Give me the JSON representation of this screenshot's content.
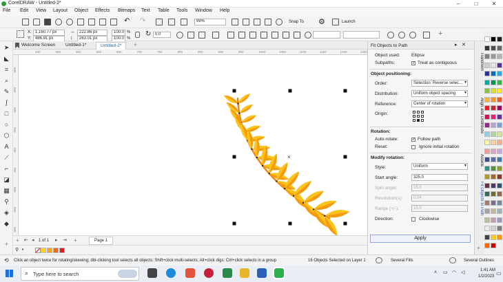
{
  "window": {
    "title": "CorelDRAW - Untitled-2*",
    "min": "–",
    "max": "□",
    "close": "✕"
  },
  "menu": [
    "File",
    "Edit",
    "View",
    "Layout",
    "Object",
    "Effects",
    "Bitmaps",
    "Text",
    "Table",
    "Tools",
    "Window",
    "Help"
  ],
  "toolbar1": {
    "zoom": "99%",
    "snap_to": "Snap To",
    "launch": "Launch"
  },
  "property_bar": {
    "x": "1,160.77 px",
    "y": "486.91 px",
    "width": "222.86 px",
    "height": "263.01 px",
    "scale_w": "100.0",
    "scale_h": "100.0",
    "pct": "%",
    "angle": "0.0",
    "x_label": "X:",
    "y_label": "Y:"
  },
  "tabs": [
    {
      "label": "Welcome Screen",
      "active": false
    },
    {
      "label": "Untitled-1*",
      "active": false
    },
    {
      "label": "Untitled-2*",
      "active": true
    }
  ],
  "ruler_ticks": [
    "450",
    "500",
    "550",
    "600",
    "650",
    "700",
    "750",
    "800",
    "850",
    "900",
    "950",
    "1000",
    "1050",
    "1100",
    "1150",
    "1200",
    "1250"
  ],
  "vruler_ticks": [
    "500",
    "550",
    "600",
    "650",
    "700",
    "750",
    "800",
    "850",
    "900"
  ],
  "pagenav": {
    "page_of": "1 of 1",
    "page_tab": "Page 1"
  },
  "docker": {
    "title": "Fit Objects to Path",
    "object_used_label": "Object used:",
    "object_used": "Ellipse",
    "subpaths_label": "Subpaths:",
    "subpaths_option": "Treat as contiguous",
    "positioning_heading": "Object positioning:",
    "order_label": "Order:",
    "order_value": "Selection: Reverse selec...",
    "distribution_label": "Distribution:",
    "distribution_value": "Uniform object spacing",
    "reference_label": "Reference:",
    "reference_value": "Center of rotation",
    "origin_label": "Origin:",
    "rotation_heading": "Rotation:",
    "auto_rotate_label": "Auto-rotate:",
    "auto_rotate_option": "Follow path",
    "reset_label": "Reset:",
    "reset_option": "Ignore initial rotation",
    "modify_heading": "Modify rotation:",
    "style_label": "Style:",
    "style_value": "Uniform",
    "start_angle_label": "Start angle:",
    "start_angle": "325.0",
    "spin_label": "Spin angle:",
    "spin_value": "15.0",
    "revolution_label": "Revolution(s):",
    "revolution_value": "0.04",
    "range_label": "Range (+/-):",
    "range_value": "15.0",
    "direction_label": "Direction:",
    "direction_option": "Clockwise",
    "apply": "Apply"
  },
  "side_tabs": [
    "Transform",
    "Align and Distribute",
    "Assets",
    "Fit Objects to Path"
  ],
  "palette_colors": [
    "#ffffff",
    "#000000",
    "#1a1a1a",
    "#333333",
    "#4d4d4d",
    "#666666",
    "#808080",
    "#999999",
    "#b3b3b3",
    "#cccccc",
    "#e6e6e6",
    "#5c2e91",
    "#2e3192",
    "#0071bc",
    "#29abe2",
    "#00a99d",
    "#009245",
    "#39b54a",
    "#8cc63f",
    "#d9e021",
    "#fcee21",
    "#fbb03b",
    "#f7931e",
    "#f15a24",
    "#ed1c24",
    "#c1272d",
    "#9e005d",
    "#d4145a",
    "#ed1e79",
    "#662d91",
    "#93278f",
    "#b3a0d6",
    "#7aa0d4",
    "#8ed1e8",
    "#a8d8a0",
    "#d6e29b",
    "#fff59b",
    "#ffd29b",
    "#f7b08e",
    "#f49a9a",
    "#e2a0c4",
    "#c9a6d4",
    "#3f4d8f",
    "#596d9f",
    "#3a7ca5",
    "#2f8f83",
    "#5a8f3c",
    "#8aa12f",
    "#b59a2a",
    "#a3662b",
    "#8c3b2b",
    "#6e2f4f",
    "#4c3a6b",
    "#2e4f6e",
    "#2e6e5a",
    "#6e6e2e",
    "#8c6a4c",
    "#a37c6e",
    "#7c6e8c",
    "#6e8ca3",
    "#a3a3a3",
    "#c4b49a",
    "#9ab4c4",
    "#b4c49a",
    "#c49ab4",
    "#9a9ac4",
    "#eaeaea",
    "#d1d1d1",
    "#7f7f7f",
    "#404040",
    "#ffcc00",
    "#ff9900",
    "#ff6600",
    "#cc0000"
  ],
  "doc_palette": [
    "#fcd21c",
    "#f7a51c",
    "#f06a1c",
    "#d81f1f"
  ],
  "status": {
    "hint": "Click an object twice for rotating/skewing; dbl-clicking tool selects all objects; Shift+click multi-selects; Alt+click digs; Ctrl+click selects in a group",
    "selection": "16 Objects Selected on Layer 1",
    "fill": "Several Fills",
    "outline": "Several Outlines"
  },
  "taskbar": {
    "search_placeholder": "Type here to search",
    "time": "1:41 AM",
    "date": "1/2/2023"
  },
  "leaf_colors": {
    "light": "#fcc419",
    "dark": "#f59c0c",
    "stem": "#f0850c"
  }
}
